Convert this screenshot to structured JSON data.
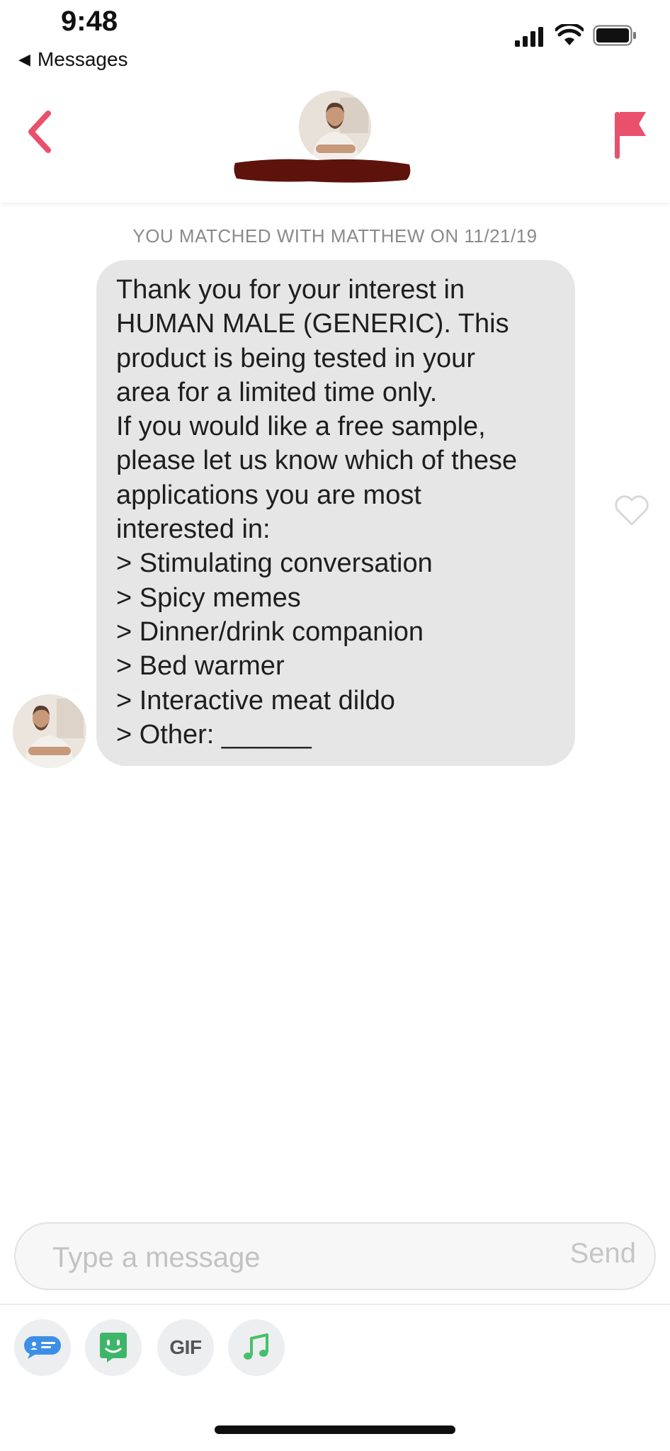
{
  "status_bar": {
    "time": "9:48",
    "back_app_label": "Messages",
    "icons": [
      "signal-icon",
      "wifi-icon",
      "battery-icon"
    ]
  },
  "header": {
    "icons": [
      "chevron-left-icon",
      "flag-icon"
    ],
    "accent_color": "#e8506b"
  },
  "chat": {
    "match_text": "YOU MATCHED WITH MATTHEW ON 11/21/19",
    "message_lines": [
      "Thank you for your interest in",
      "HUMAN MALE (GENERIC). This",
      "product is being tested in your",
      "area for a limited time only.",
      "If you would like a free sample,",
      "please let us know which of these",
      "applications you are most",
      "interested in:",
      "> Stimulating conversation",
      "> Spicy memes",
      "> Dinner/drink companion",
      "> Bed warmer",
      "> Interactive meat dildo",
      "> Other: ______"
    ],
    "bubble_color": "#e6e6e6",
    "like_icon": "heart-outline-icon"
  },
  "composer": {
    "placeholder": "Type a message",
    "send_label": "Send"
  },
  "tools": {
    "gif_label": "GIF",
    "icons": [
      "chat-card-icon",
      "sticker-icon",
      "gif-icon",
      "music-note-icon"
    ]
  }
}
